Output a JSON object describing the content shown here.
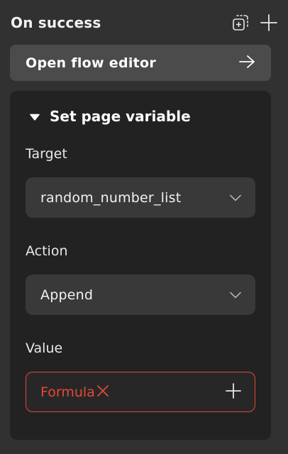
{
  "header": {
    "title": "On success",
    "icons": [
      "add-layer-icon",
      "plus-icon"
    ]
  },
  "flow_editor": {
    "label": "Open flow editor",
    "icon": "arrow-right-icon"
  },
  "action_block": {
    "title": "Set page variable",
    "collapse_icon": "triangle-down-icon",
    "target": {
      "label": "Target",
      "value": "random_number_list"
    },
    "action": {
      "label": "Action",
      "value": "Append"
    },
    "value_field": {
      "label": "Value",
      "formula_text": "Formula",
      "error_icon": "close-x-icon",
      "add_icon": "plus-icon"
    }
  },
  "colors": {
    "background": "#313131",
    "panel": "#222222",
    "button": "#4b4b4b",
    "select": "#393939",
    "error": "#e1483e"
  }
}
